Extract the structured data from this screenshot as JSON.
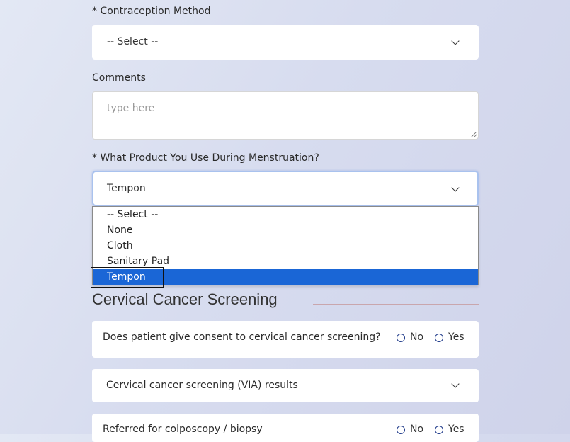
{
  "contraception": {
    "label": "* Contraception Method",
    "selected": "-- Select --"
  },
  "comments": {
    "label": "Comments",
    "placeholder": "type here"
  },
  "menstruation": {
    "label": "* What Product You Use During Menstruation?",
    "selected": "Tempon",
    "options": [
      "-- Select --",
      "None",
      "Cloth",
      "Sanitary Pad",
      "Tempon"
    ]
  },
  "cervical": {
    "title": "Cervical Cancer Screening",
    "consent": {
      "question": "Does patient give consent to cervical cancer screening?",
      "no": "No",
      "yes": "Yes"
    },
    "via": {
      "label": "Cervical cancer screening (VIA) results"
    },
    "referred": {
      "question": "Referred for colposcopy / biopsy",
      "no": "No",
      "yes": "Yes"
    }
  },
  "colors": {
    "selected_option": "#1a66d6",
    "radio_border": "#1f3a8a",
    "section_rule": "#c9a6ad"
  }
}
